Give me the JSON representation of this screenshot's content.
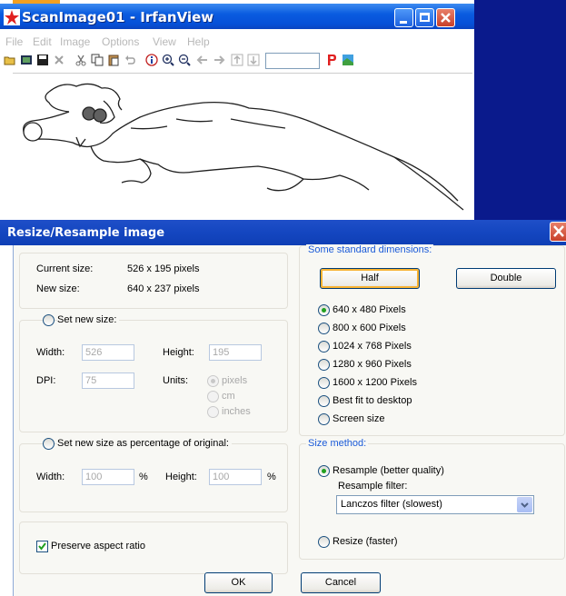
{
  "irfanview": {
    "title": "ScanImage01 - IrfanView",
    "menu": [
      "File",
      "Edit",
      "Image",
      "Options",
      "View",
      "Help"
    ]
  },
  "dialog": {
    "title": "Resize/Resample image",
    "current_size_label": "Current size:",
    "current_size_value": "526 x 195 pixels",
    "new_size_label": "New size:",
    "new_size_value": "640 x 237 pixels",
    "set_new_size": {
      "label": "Set new size:",
      "width_label": "Width:",
      "width_value": "526",
      "height_label": "Height:",
      "height_value": "195",
      "dpi_label": "DPI:",
      "dpi_value": "75",
      "units_label": "Units:",
      "units": [
        "pixels",
        "cm",
        "inches"
      ]
    },
    "percentage": {
      "label": "Set new size as percentage of original:",
      "width_label": "Width:",
      "width_value": "100",
      "height_label": "Height:",
      "height_value": "100",
      "pct": "%"
    },
    "preserve_aspect": "Preserve aspect ratio",
    "standard": {
      "group_label": "Some standard dimensions:",
      "half_button": "Half",
      "double_button": "Double",
      "options": [
        "640 x 480 Pixels",
        "800 x 600 Pixels",
        "1024 x 768 Pixels",
        "1280 x 960 Pixels",
        "1600 x 1200 Pixels",
        "Best fit to desktop",
        "Screen size"
      ]
    },
    "method": {
      "group_label": "Size method:",
      "resample": "Resample (better quality)",
      "filter_label": "Resample filter:",
      "filter_value": "Lanczos filter (slowest)",
      "resize": "Resize (faster)"
    },
    "ok": "OK",
    "cancel": "Cancel"
  }
}
